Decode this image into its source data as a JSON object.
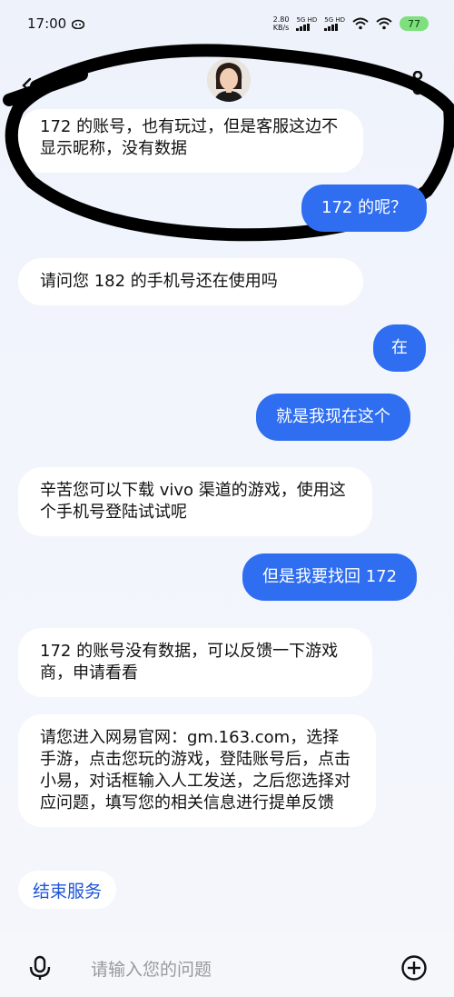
{
  "status_bar": {
    "time": "17:00",
    "net_speed_value": "2.80",
    "net_speed_unit": "KB/s",
    "sim1": "5G HD",
    "sim2": "5G HD",
    "battery": "77"
  },
  "messages": {
    "m1": "172 的账号，也有玩过，但是客服这边不显示昵称，没有数据",
    "m2": "172 的呢？",
    "m3": "请问您 182 的手机号还在使用吗",
    "m4": "在",
    "m5": "就是我现在这个",
    "m6": "辛苦您可以下载 vivo 渠道的游戏，使用这个手机号登陆试试呢",
    "m7": "但是我要找回 172",
    "m8": "172 的账号没有数据，可以反馈一下游戏商，申请看看",
    "m9": "请您进入网易官网：gm.163.com，选择手游，点击您玩的游戏，登陆账号后，点击小易，对话框输入人工发送，之后您选择对应问题，填写您的相关信息进行提单反馈"
  },
  "end_service": "结束服务",
  "input": {
    "placeholder": "请输入您的问题"
  },
  "colors": {
    "accent": "#2f6ef0",
    "link": "#1f55d8"
  }
}
